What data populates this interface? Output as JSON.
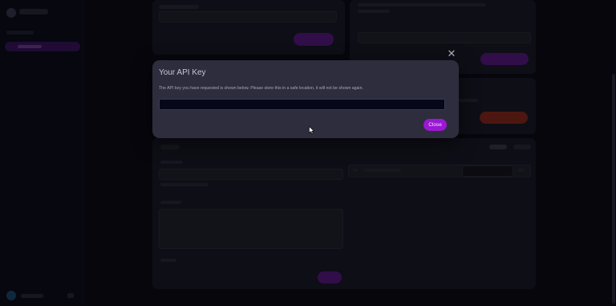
{
  "modal": {
    "title": "Your API Key",
    "description": "The API key you have requested is shown below. Please store this in a safe location, it will not be shown again.",
    "api_key_value": "",
    "close_button_label": "Close",
    "dismiss_icon": "close-icon"
  },
  "colors": {
    "accent": "#9b18d2",
    "danger": "#8a2a20",
    "page_background": "#0b0b17",
    "modal_background": "#2d2d3e",
    "key_field_background": "#07071a"
  }
}
